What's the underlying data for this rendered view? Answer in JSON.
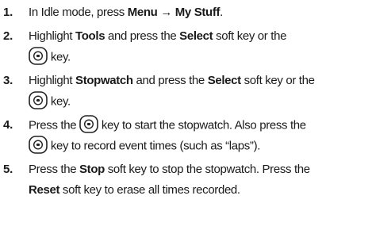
{
  "steps": [
    {
      "number": "1.",
      "lines": [
        {
          "t1": "In Idle mode, press ",
          "b1": "Menu → My Stuff",
          "t2": "."
        }
      ]
    },
    {
      "number": "2.",
      "lines": [
        {
          "t1": "Highlight ",
          "b1": "Tools",
          "t2": " and press the ",
          "b2": "Select",
          "t3": " soft key or the"
        },
        {
          "t_after_icon": " key."
        }
      ]
    },
    {
      "number": "3.",
      "lines": [
        {
          "t1": "Highlight ",
          "b1": "Stopwatch",
          "t2": " and press the ",
          "b2": "Select",
          "t3": " soft key or the"
        },
        {
          "t_after_icon": " key."
        }
      ]
    },
    {
      "number": "4.",
      "lines": [
        {
          "t1": "Press the ",
          "t2": " key to start the stopwatch. Also press the"
        },
        {
          "t_after_icon": " key to record event times (such as “laps”)."
        }
      ]
    },
    {
      "number": "5.",
      "lines": [
        {
          "t1": "Press the ",
          "b1": "Stop",
          "t2": " soft key to stop the stopwatch. Press the"
        },
        {
          "b1": "Reset",
          "t2": " soft key to erase all times recorded."
        }
      ]
    }
  ],
  "icons": {
    "center_key": "center-select-key-icon"
  }
}
